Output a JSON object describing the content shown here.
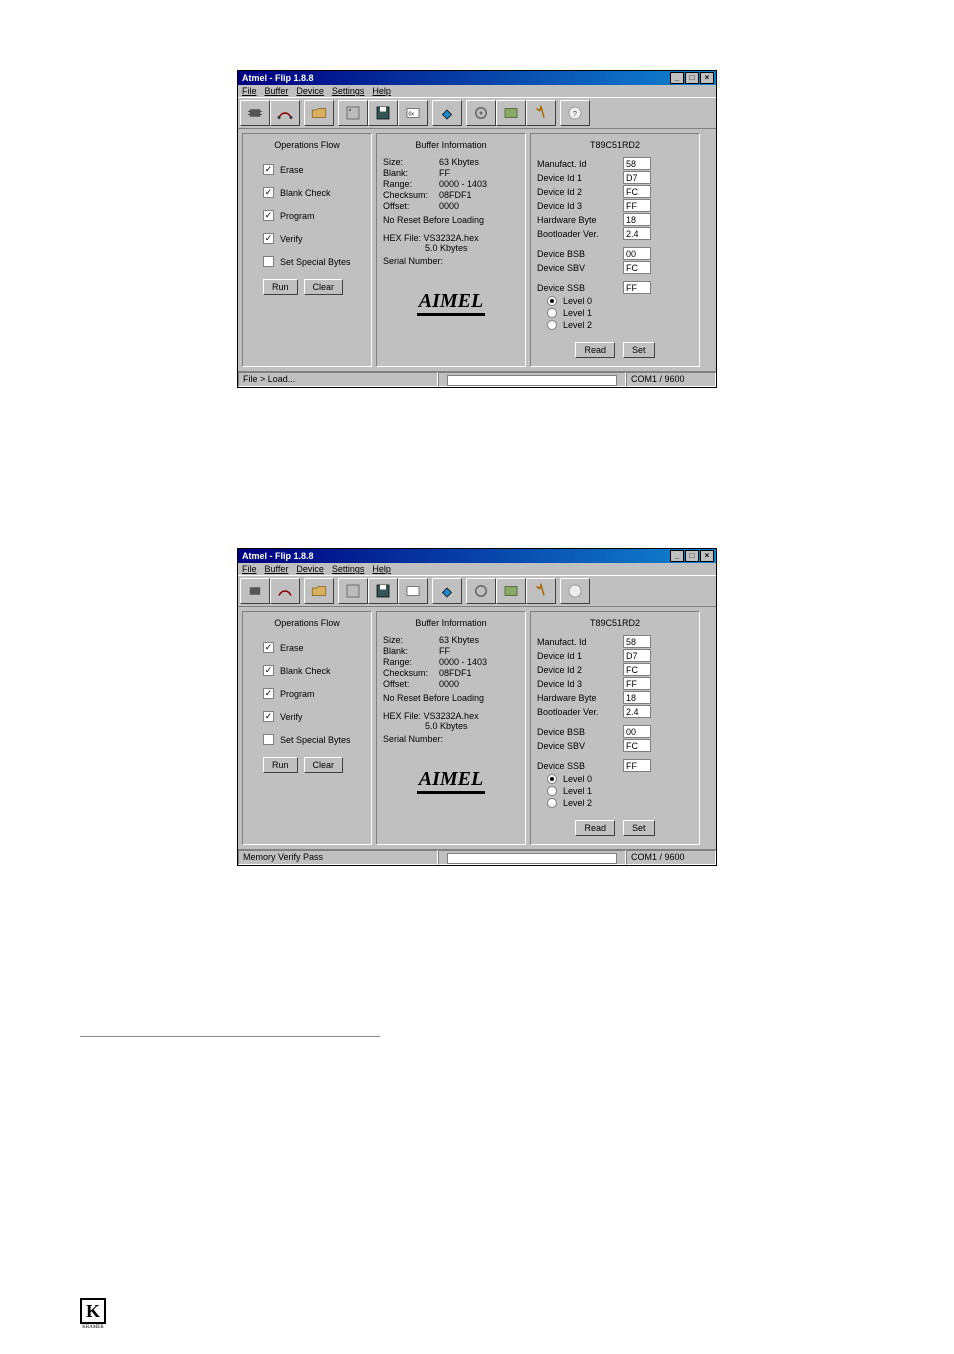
{
  "window": {
    "title": "Atmel - Flip 1.8.8",
    "menus": [
      "File",
      "Buffer",
      "Device",
      "Settings",
      "Help"
    ],
    "sysbuttons": [
      "_",
      "□",
      "×"
    ]
  },
  "ops": {
    "title": "Operations Flow",
    "erase": "Erase",
    "blank": "Blank Check",
    "program": "Program",
    "verify": "Verify",
    "ssb": "Set Special Bytes",
    "run": "Run",
    "clear": "Clear"
  },
  "buf": {
    "title": "Buffer Information",
    "size_k": "Size:",
    "size_v": "63 Kbytes",
    "blank_k": "Blank:",
    "blank_v": "FF",
    "range_k": "Range:",
    "range_v": "0000 - 1403",
    "check_k": "Checksum:",
    "check_v": "08FDF1",
    "offset_k": "Offset:",
    "offset_v": "0000",
    "noreset": "No Reset Before Loading",
    "hex_k": "HEX File:",
    "hex_v": "VS3232A.hex",
    "hex_size": "5.0 Kbytes",
    "serial": "Serial Number:",
    "logo": "AIMEL"
  },
  "dev": {
    "title": "T89C51RD2",
    "rows": [
      {
        "lbl": "Manufact. Id",
        "val": "58"
      },
      {
        "lbl": "Device Id 1",
        "val": "D7"
      },
      {
        "lbl": "Device Id 2",
        "val": "FC"
      },
      {
        "lbl": "Device Id 3",
        "val": "FF"
      },
      {
        "lbl": "Hardware Byte",
        "val": "18"
      },
      {
        "lbl": "Bootloader Ver.",
        "val": "2.4"
      }
    ],
    "rows2": [
      {
        "lbl": "Device BSB",
        "val": "00"
      },
      {
        "lbl": "Device SBV",
        "val": "FC"
      }
    ],
    "ssb_label": "Device SSB",
    "ssb_val": "FF",
    "level0": "Level 0",
    "level1": "Level 1",
    "level2": "Level 2",
    "read": "Read",
    "set": "Set"
  },
  "status1": {
    "left": "File > Load...",
    "right": "COM1 / 9600"
  },
  "status2": {
    "left": "Memory Verify Pass",
    "right": "COM1 / 9600"
  },
  "footer_logo": "K",
  "footer_sub": "KRAMER"
}
